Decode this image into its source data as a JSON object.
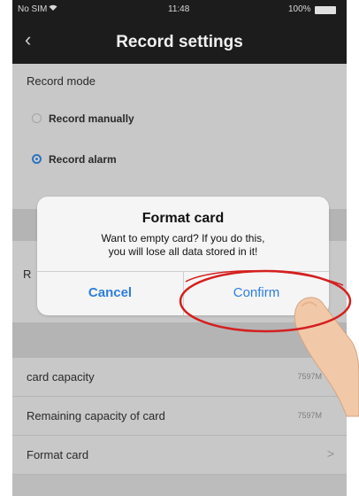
{
  "status_bar": {
    "carrier": "No SIM",
    "time": "11:48",
    "battery": "100%"
  },
  "nav": {
    "back_icon": "‹",
    "title": "Record settings"
  },
  "record_mode": {
    "label": "Record mode",
    "options": [
      {
        "label": "Record manually",
        "selected": false
      },
      {
        "label": "Record alarm",
        "selected": true
      }
    ]
  },
  "partial_row_label": "R",
  "storage": [
    {
      "label": "card capacity",
      "value": "7597M"
    },
    {
      "label": "Remaining capacity of  card",
      "value": "7597M"
    },
    {
      "label": "Format card",
      "value": "",
      "chevron": ">"
    }
  ],
  "dialog": {
    "title": "Format card",
    "message_line1": "Want to empty  card? If you do this,",
    "message_line2": "you will lose all data stored in it!",
    "cancel": "Cancel",
    "confirm": "Confirm"
  },
  "colors": {
    "accent": "#2d7ee0",
    "highlight_ring": "#d42020",
    "header": "#1c1c1c"
  }
}
